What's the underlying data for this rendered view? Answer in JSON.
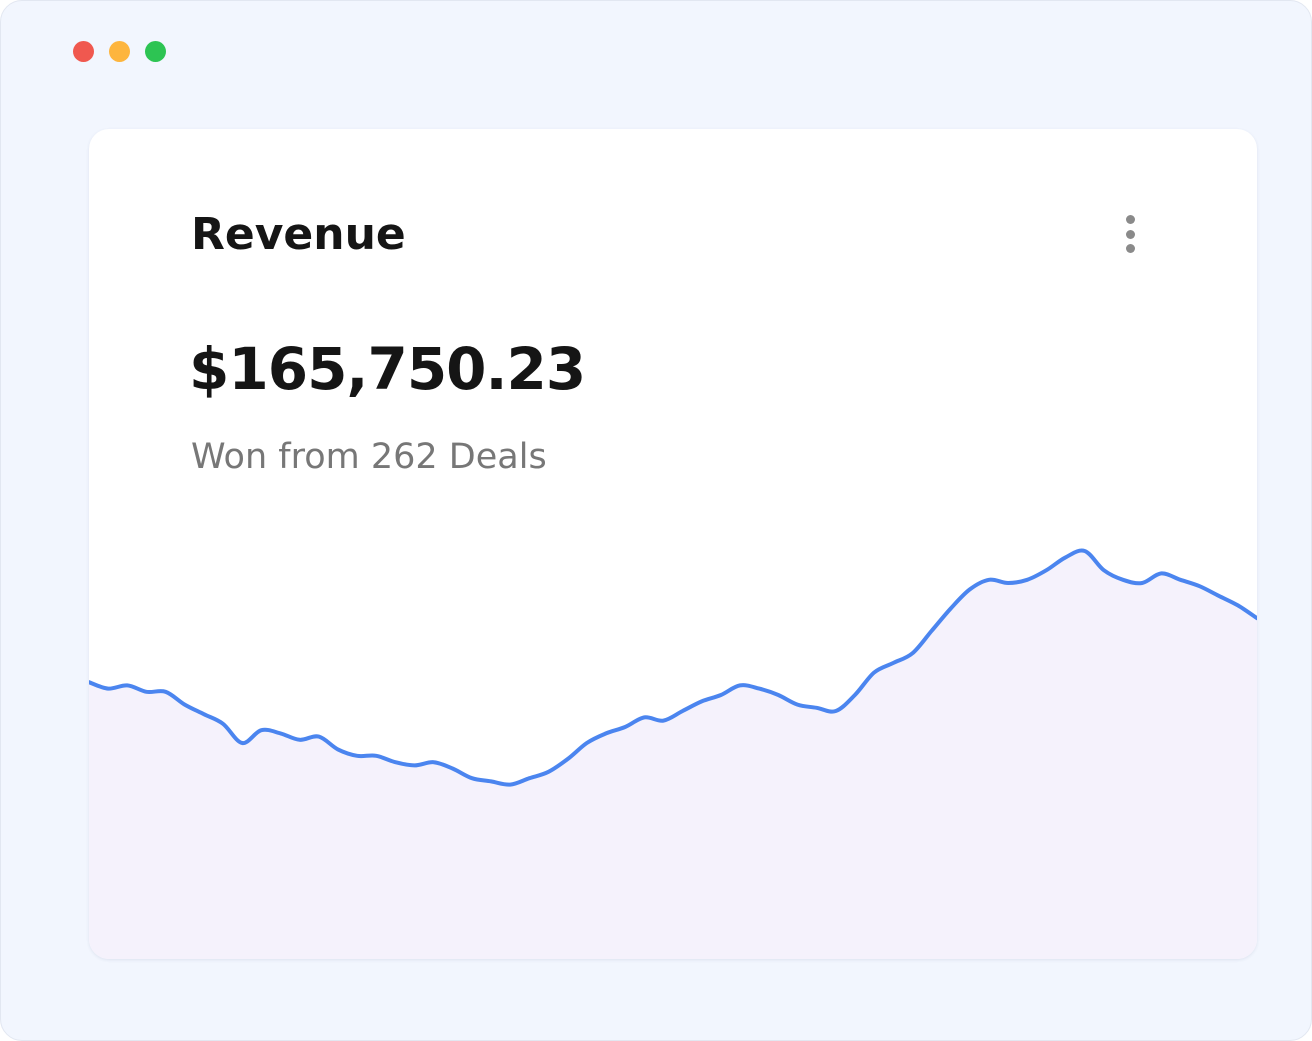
{
  "colors": {
    "window_background": "#f2f6fe",
    "card_background": "#ffffff",
    "traffic_close": "#f0584f",
    "traffic_minimize": "#fdb53e",
    "traffic_maximize": "#2dc453",
    "line": "#4b85ef",
    "area_fill": "#f5f2fc",
    "menu_dots": "#8a8a8a"
  },
  "card": {
    "title": "Revenue",
    "amount": "$165,750.23",
    "subtitle": "Won from 262 Deals",
    "menu_icon": "more-vertical-icon"
  },
  "chart_data": {
    "type": "area",
    "ylim": [
      0,
      100
    ],
    "grid": false,
    "values": [
      49,
      47,
      48,
      46,
      46,
      42,
      39,
      36,
      30,
      34,
      33,
      31,
      32,
      28,
      26,
      26,
      24,
      23,
      24,
      22,
      19,
      18,
      17,
      19,
      21,
      25,
      30,
      33,
      35,
      38,
      37,
      40,
      43,
      45,
      48,
      47,
      45,
      42,
      41,
      40,
      45,
      52,
      55,
      58,
      65,
      72,
      78,
      81,
      80,
      81,
      84,
      88,
      90,
      84,
      81,
      80,
      83,
      81,
      79,
      76,
      73,
      69
    ]
  }
}
